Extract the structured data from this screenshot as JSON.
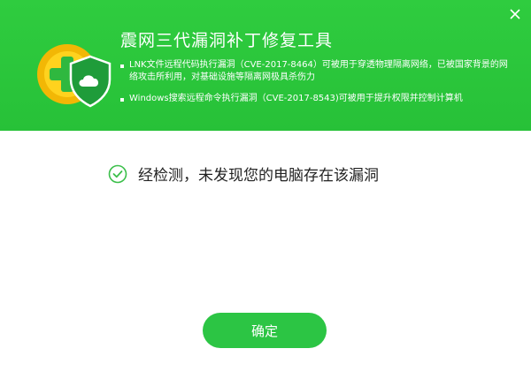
{
  "header": {
    "title": "震网三代漏洞补丁修复工具",
    "bullets": [
      "LNK文件远程代码执行漏洞（CVE-2017-8464）可被用于穿透物理隔离网络，已被国家背景的网络攻击所利用，对基础设施等隔离网极具杀伤力",
      "Windows搜索远程命令执行漏洞（CVE-2017-8543)可被用于提升权限并控制计算机"
    ]
  },
  "result": {
    "message": "经检测，未发现您的电脑存在该漏洞",
    "icon": "check-circle-icon"
  },
  "footer": {
    "confirm_label": "确定"
  },
  "colors": {
    "header_bg": "#2fcc3f",
    "button_bg": "#2cc544",
    "check": "#3bbf4a"
  }
}
